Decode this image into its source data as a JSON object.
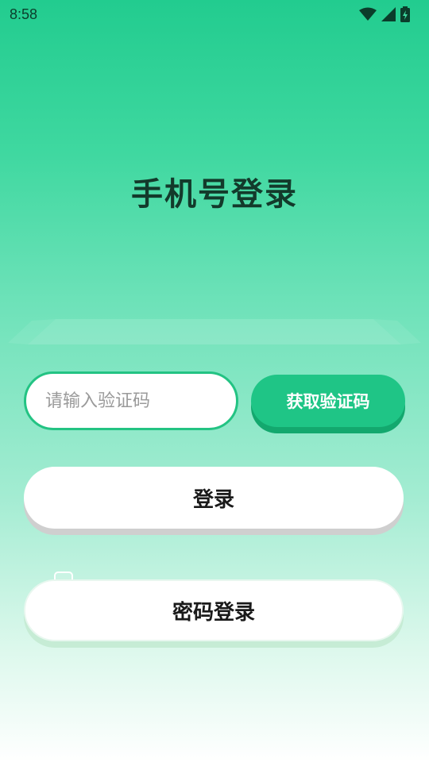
{
  "status_bar": {
    "time": "8:58",
    "icons": [
      "wifi-icon",
      "signal-icon",
      "battery-charging-icon"
    ]
  },
  "page": {
    "title": "手机号登录"
  },
  "form": {
    "code_placeholder": "请输入验证码",
    "code_value": "",
    "get_code_label": "获取验证码",
    "login_label": "登录",
    "password_login_label": "密码登录"
  },
  "colors": {
    "accent": "#1fc586",
    "accent_border": "#23c383",
    "title": "#133a2b"
  }
}
